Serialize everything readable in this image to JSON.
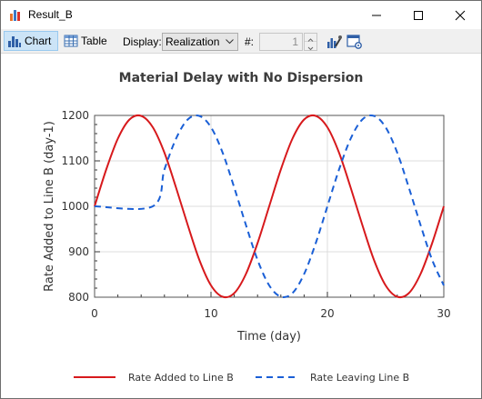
{
  "window": {
    "title": "Result_B"
  },
  "toolbar": {
    "chart_label": "Chart",
    "table_label": "Table",
    "display_label": "Display:",
    "display_value": "Realization",
    "number_label": "#:",
    "number_value": "1"
  },
  "colors": {
    "series_added": "#d7191c",
    "series_leaving": "#1a5fd6",
    "active_tab_bg": "#cce4f7"
  },
  "icons": [
    "chart-bar-icon",
    "table-icon",
    "chevron-down-icon",
    "chart-properties-icon",
    "chart-settings-icon",
    "minimize-icon",
    "maximize-icon",
    "close-icon"
  ],
  "chart_data": {
    "type": "line",
    "title": "Material Delay with No Dispersion",
    "xlabel": "Time (day)",
    "ylabel": "Rate Added to Line B (day-1)",
    "xlim": [
      0,
      30
    ],
    "ylim": [
      800,
      1200
    ],
    "xticks": [
      0,
      10,
      20,
      30
    ],
    "yticks": [
      800,
      900,
      1000,
      1100,
      1200
    ],
    "grid": true,
    "legend_position": "bottom",
    "series": [
      {
        "name": "Rate Added to Line B",
        "style": "solid",
        "color": "#d7191c",
        "x": [
          0,
          1,
          2,
          3,
          4,
          5,
          6,
          7,
          8,
          9,
          10,
          11,
          12,
          13,
          14,
          15,
          16,
          17,
          18,
          19,
          20,
          21,
          22,
          23,
          24,
          25,
          26,
          27,
          28,
          29,
          30
        ],
        "y": [
          1000,
          1081,
          1149,
          1191,
          1199,
          1174,
          1118,
          1041,
          959,
          882,
          826,
          801,
          809,
          851,
          919,
          1000,
          1081,
          1149,
          1191,
          1199,
          1174,
          1118,
          1041,
          959,
          882,
          826,
          801,
          809,
          851,
          919,
          1000
        ]
      },
      {
        "name": "Rate Leaving Line B",
        "style": "dashed",
        "color": "#1a5fd6",
        "x": [
          0,
          5,
          6,
          7,
          8,
          9,
          10,
          11,
          12,
          13,
          14,
          15,
          16,
          17,
          18,
          19,
          20,
          21,
          22,
          23,
          24,
          25,
          26,
          27,
          28,
          29,
          30
        ],
        "y": [
          1000,
          1000,
          1081,
          1149,
          1191,
          1199,
          1174,
          1118,
          1041,
          959,
          882,
          826,
          801,
          809,
          851,
          919,
          1000,
          1081,
          1149,
          1191,
          1199,
          1174,
          1118,
          1041,
          959,
          882,
          826
        ]
      }
    ]
  }
}
